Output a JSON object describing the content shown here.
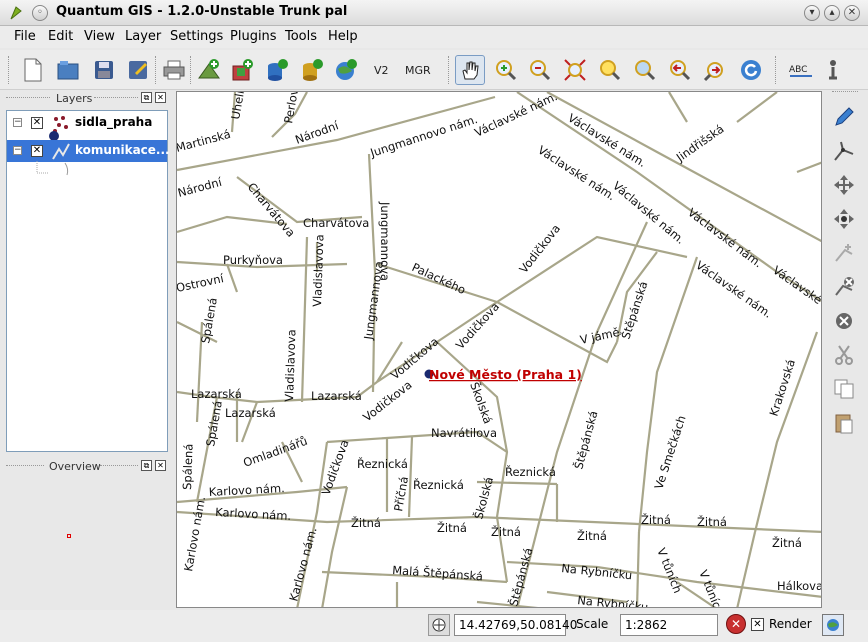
{
  "window": {
    "title": "Quantum GIS - 1.2.0-Unstable Trunk pal"
  },
  "menu": [
    "File",
    "Edit",
    "View",
    "Layer",
    "Settings",
    "Plugins",
    "Tools",
    "Help"
  ],
  "toolbar": {
    "v2_label": "V2",
    "mgr_label": "MGR"
  },
  "layers_panel": {
    "title": "Layers",
    "layers": [
      {
        "name": "sidla_praha",
        "checked": "✕",
        "icon": "point-layer-icon"
      },
      {
        "name": "komunikace...",
        "checked": "✕",
        "icon": "line-layer-icon",
        "selected": true
      }
    ]
  },
  "overview_panel": {
    "title": "Overview"
  },
  "map": {
    "place_label": "Nové Město (Praha 1)",
    "street_labels": [
      "Národní",
      "Jungmannovo nám.",
      "Václavské nám.",
      "Jindřišská",
      "Uhelný",
      "Perlová",
      "Martinská",
      "Charvátova",
      "Jungmannova",
      "Vodičkova",
      "Palackého",
      "Purkyňova",
      "Vladislavova",
      "Spálená",
      "Štěpánská",
      "V jámě",
      "Školská",
      "Lazarská",
      "Navrátilova",
      "Omladinářů",
      "Karlovo nám.",
      "Řeznická",
      "Příčná",
      "Žitná",
      "Ve Smečkách",
      "Krakovská",
      "Malá Štěpánská",
      "Na Rybníčku",
      "V tůních",
      "Hálkova",
      "Ostrovní",
      "Na Rybníčku"
    ]
  },
  "status": {
    "coordinates": "14.42769,50.08140",
    "scale_label": "Scale",
    "scale_value": "1:2862",
    "render_label": "Render",
    "render_checked": "✕"
  },
  "colors": {
    "roads": "#a8a68a",
    "selection": "#3875d7",
    "place_label": "#c00000"
  }
}
